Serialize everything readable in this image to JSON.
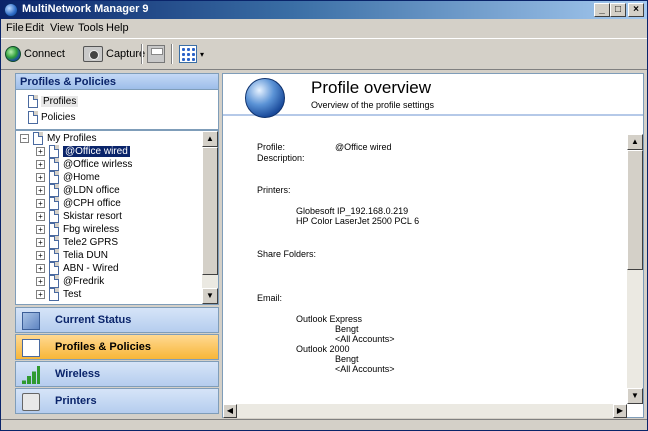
{
  "window": {
    "title": "MultiNetwork Manager 9",
    "min_label": "_",
    "max_label": "□",
    "close_label": "×"
  },
  "menu": [
    "File",
    "Edit",
    "View",
    "Tools",
    "Help"
  ],
  "toolbar": {
    "connect_label": "Connect",
    "capture_label": "Capture",
    "dropdown_arrow": "▾"
  },
  "left_panel": {
    "header": "Profiles & Policies",
    "items": [
      {
        "label": "Profiles",
        "selected": true
      },
      {
        "label": "Policies",
        "selected": false
      }
    ],
    "tree": {
      "root": "My Profiles",
      "root_expander": "−",
      "child_expander": "+",
      "children": [
        "@Office wired",
        "@Office wirless",
        "@Home",
        "@LDN office",
        "@CPH office",
        "Skistar resort",
        "Fbg wireless",
        "Tele2 GPRS",
        "Telia DUN",
        "ABN - Wired",
        "@Fredrik",
        "Test"
      ],
      "selected": "@Office wired"
    },
    "nav_buttons": [
      {
        "label": "Current Status",
        "icon": "status-icon",
        "active": false
      },
      {
        "label": "Profiles & Policies",
        "icon": "profile-icon",
        "active": true
      },
      {
        "label": "Wireless",
        "icon": "wireless-signal-icon",
        "active": false
      },
      {
        "label": "Printers",
        "icon": "printer-icon",
        "active": false
      }
    ]
  },
  "right_panel": {
    "title": "Profile overview",
    "subtitle": "Overview of the profile settings",
    "profile_label": "Profile:",
    "profile_value": "@Office wired",
    "description_label": "Description:",
    "printers_label": "Printers:",
    "printers": [
      "Globesoft IP_192.168.0.219",
      "HP Color LaserJet 2500 PCL 6"
    ],
    "share_folders_label": "Share Folders:",
    "email_label": "Email:",
    "email_clients": [
      {
        "name": "Outlook Express",
        "account": "Bengt",
        "scope": "<All Accounts>"
      },
      {
        "name": "Outlook 2000",
        "account": "Bengt",
        "scope": "<All Accounts>"
      }
    ]
  },
  "scroll_arrows": {
    "up": "▲",
    "down": "▼",
    "left": "◀",
    "right": "▶"
  },
  "colors": {
    "selection": "#0a246a",
    "active_nav": "#f7b638",
    "panel_blue": "#b5cdee"
  }
}
